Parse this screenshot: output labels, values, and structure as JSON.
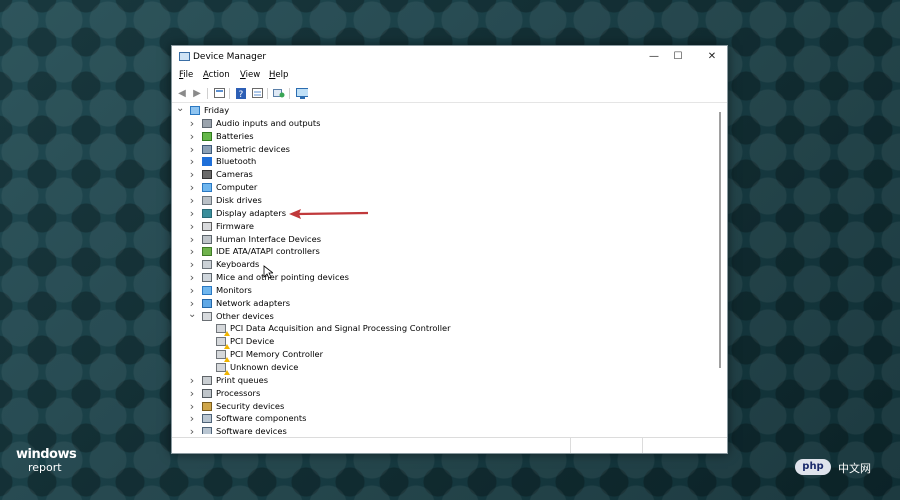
{
  "window": {
    "title": "Device Manager",
    "minimize_glyph": "—",
    "maximize_glyph": "☐",
    "close_glyph": "✕"
  },
  "menu": {
    "file_accel": "F",
    "file_rest": "ile",
    "action_accel": "A",
    "action_rest": "ction",
    "view_accel": "V",
    "view_rest": "iew",
    "help_accel": "H",
    "help_rest": "elp"
  },
  "tree": {
    "root": "Friday",
    "items": [
      {
        "label": "Audio inputs and outputs",
        "icon": "speaker-icon"
      },
      {
        "label": "Batteries",
        "icon": "battery-icon"
      },
      {
        "label": "Biometric devices",
        "icon": "fingerprint-icon"
      },
      {
        "label": "Bluetooth",
        "icon": "bluetooth-icon"
      },
      {
        "label": "Cameras",
        "icon": "camera-icon"
      },
      {
        "label": "Computer",
        "icon": "monitor-icon"
      },
      {
        "label": "Disk drives",
        "icon": "disk-icon"
      },
      {
        "label": "Display adapters",
        "icon": "display-adapter-icon"
      },
      {
        "label": "Firmware",
        "icon": "chip-icon"
      },
      {
        "label": "Human Interface Devices",
        "icon": "hid-icon"
      },
      {
        "label": "IDE ATA/ATAPI controllers",
        "icon": "controller-icon"
      },
      {
        "label": "Keyboards",
        "icon": "keyboard-icon"
      },
      {
        "label": "Mice and other pointing devices",
        "icon": "mouse-icon"
      },
      {
        "label": "Monitors",
        "icon": "monitor-icon"
      },
      {
        "label": "Network adapters",
        "icon": "network-icon"
      },
      {
        "label": "Other devices",
        "icon": "unknown-device-icon"
      },
      {
        "label": "Print queues",
        "icon": "printer-icon"
      },
      {
        "label": "Processors",
        "icon": "processor-icon"
      },
      {
        "label": "Security devices",
        "icon": "security-icon"
      },
      {
        "label": "Software components",
        "icon": "component-icon"
      },
      {
        "label": "Software devices",
        "icon": "component-icon"
      }
    ],
    "other_children": [
      "PCI Data Acquisition and Signal Processing Controller",
      "PCI Device",
      "PCI Memory Controller",
      "Unknown device"
    ]
  },
  "overlay": {
    "logo_line1": "windows",
    "logo_line2": "report",
    "badge": "php",
    "badge_cn": "中文网",
    "arrow_color": "#c0393b"
  }
}
